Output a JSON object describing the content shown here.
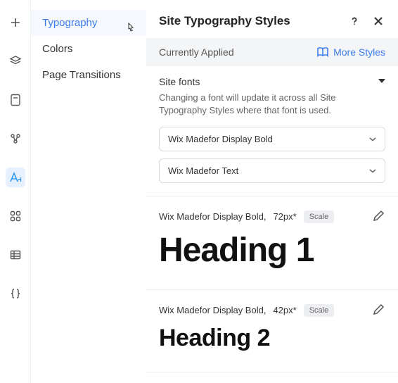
{
  "rail": {
    "items": [
      {
        "name": "plus-icon"
      },
      {
        "name": "layers-icon"
      },
      {
        "name": "page-icon"
      },
      {
        "name": "share-icon"
      },
      {
        "name": "typography-icon"
      },
      {
        "name": "grid-icon"
      },
      {
        "name": "table-icon"
      },
      {
        "name": "braces-icon"
      }
    ],
    "active_index": 4
  },
  "sidebar": {
    "items": [
      {
        "label": "Typography"
      },
      {
        "label": "Colors"
      },
      {
        "label": "Page Transitions"
      }
    ],
    "active_index": 0
  },
  "panel": {
    "title": "Site Typography Styles",
    "applied_bar": {
      "label": "Currently Applied",
      "more": "More Styles"
    },
    "site_fonts": {
      "title": "Site fonts",
      "desc": "Changing a font will update it across all Site Typography Styles where that font is used.",
      "selects": [
        {
          "value": "Wix Madefor Display Bold"
        },
        {
          "value": "Wix Madefor Text"
        }
      ]
    },
    "styles": [
      {
        "font": "Wix Madefor Display Bold,",
        "size": "72px*",
        "scale": "Scale",
        "sample": "Heading 1"
      },
      {
        "font": "Wix Madefor Display Bold,",
        "size": "42px*",
        "scale": "Scale",
        "sample": "Heading 2"
      }
    ]
  }
}
